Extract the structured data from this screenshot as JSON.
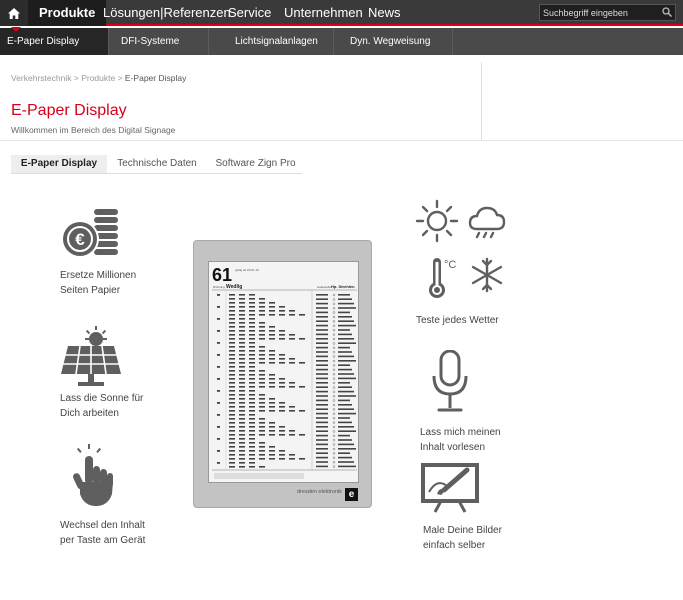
{
  "topnav": {
    "items": [
      "Produkte",
      "Lösungen|Referenzen",
      "Service",
      "Unternehmen",
      "News"
    ],
    "search_placeholder": "Suchbegriff eingeben"
  },
  "subnav": {
    "items": [
      "E-Paper Display",
      "DFI-Systeme",
      "Lichtsignalanlagen",
      "Dyn. Wegweisung"
    ]
  },
  "breadcrumb": {
    "items": [
      "Verkehrstechnik",
      "Produkte",
      "E-Paper Display"
    ]
  },
  "page": {
    "title": "E-Paper Display",
    "subtitle": "Willkommen im Bereich des Digital Signage"
  },
  "tabs": [
    "E-Paper Display",
    "Technische Daten",
    "Software Zign Pro"
  ],
  "features": {
    "left": [
      {
        "icon": "euro-coins-icon",
        "text": "Ersetze Millionen\nSeiten Papier"
      },
      {
        "icon": "solar-panel-icon",
        "text": "Lass die Sonne für\nDich arbeiten"
      },
      {
        "icon": "touch-hand-icon",
        "text": "Wechsel den Inhalt\nper Taste am Gerät"
      }
    ],
    "right": [
      {
        "icon": "weather-icons",
        "text": "Teste jedes Wetter"
      },
      {
        "icon": "microphone-icon",
        "text": "Lass mich meinen\nInhalt vorlesen"
      },
      {
        "icon": "drawing-tablet-icon",
        "text": "Male Deine Bilder\neinfach selber"
      }
    ]
  },
  "device": {
    "route_number": "61",
    "stop_label": "Wedlig",
    "destination_label": "Hp. Strehlen",
    "brand": "dresden elektronik",
    "brand_mark": "e"
  },
  "colors": {
    "accent": "#d6001c",
    "topnav_bg": "#3a3a3a",
    "subnav_bg": "#4a4a4a",
    "icon": "#5f5f5f"
  }
}
